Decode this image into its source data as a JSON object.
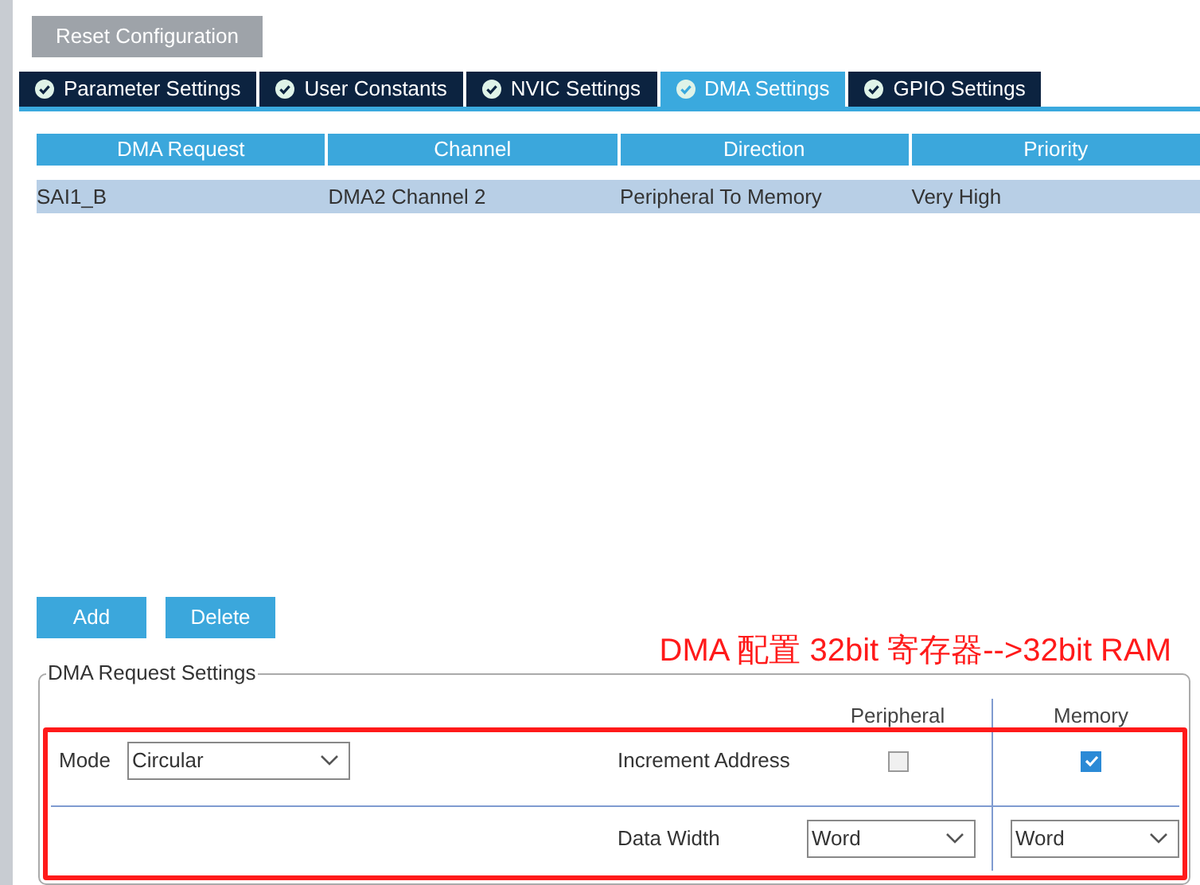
{
  "reset_button": "Reset Configuration",
  "tabs": [
    {
      "label": "Parameter Settings",
      "selected": false
    },
    {
      "label": "User Constants",
      "selected": false
    },
    {
      "label": "NVIC Settings",
      "selected": false
    },
    {
      "label": "DMA Settings",
      "selected": true
    },
    {
      "label": "GPIO Settings",
      "selected": false
    }
  ],
  "table": {
    "columns": [
      "DMA Request",
      "Channel",
      "Direction",
      "Priority"
    ],
    "rows": [
      {
        "cells": [
          "SAI1_B",
          "DMA2 Channel 2",
          "Peripheral To Memory",
          "Very High"
        ],
        "selected": true
      }
    ]
  },
  "actions": [
    "Add",
    "Delete"
  ],
  "annotation": "DMA 配置 32bit 寄存器-->32bit RAM",
  "request_settings": {
    "title": "DMA Request Settings",
    "columns": [
      "Peripheral",
      "Memory"
    ],
    "mode": {
      "label": "Mode",
      "value": "Circular"
    },
    "increment_address": {
      "label": "Increment Address",
      "peripheral_checked": false,
      "memory_checked": true
    },
    "data_width": {
      "label": "Data Width",
      "peripheral": "Word",
      "memory": "Word"
    }
  }
}
